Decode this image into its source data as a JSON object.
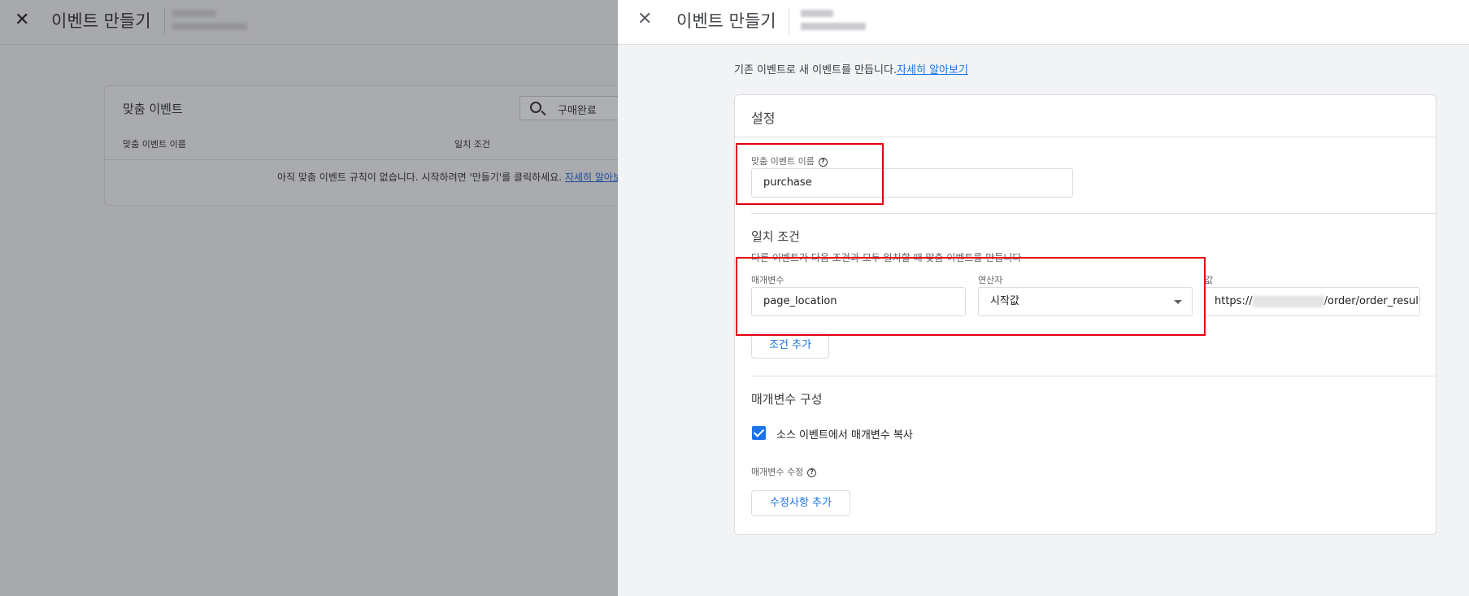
{
  "background": {
    "close_icon": "close-icon",
    "title": "이벤트 만들기",
    "card": {
      "title": "맞춤 이벤트",
      "search_value": "구매완료",
      "columns": [
        "맞춤 이벤트 이름",
        "일치 조건"
      ],
      "empty_text": "아직 맞춤 이벤트 규칙이 없습니다. 시작하려면 '만들기'를 클릭하세요.",
      "empty_link": "자세히 알아보기"
    }
  },
  "panel": {
    "close_icon": "close-icon",
    "title": "이벤트 만들기",
    "intro_text": "기존 이벤트로 새 이벤트를 만듭니다.",
    "intro_link": "자세히 알아보기",
    "settings_title": "설정",
    "custom_event": {
      "label": "맞춤 이벤트 이름",
      "help_icon": "help-icon",
      "value": "purchase"
    },
    "match": {
      "title": "일치 조건",
      "description": "다른 이벤트가 다음 조건과 모두 일치할 때 맞춤 이벤트를 만듭니다",
      "param_label": "매개변수",
      "param_value": "page_location",
      "operator_label": "연산자",
      "operator_value": "시작값",
      "value_label": "값",
      "value_prefix": "https://",
      "value_suffix": "/order/order_result.ht",
      "add_condition": "조건 추가"
    },
    "params": {
      "title": "매개변수 구성",
      "copy_checked": true,
      "copy_label": "소스 이벤트에서 매개변수 복사",
      "modify_label": "매개변수 수정",
      "add_modification": "수정사항 추가"
    },
    "highlight_color": "#e3000f",
    "accent_color": "#1a73e8"
  }
}
